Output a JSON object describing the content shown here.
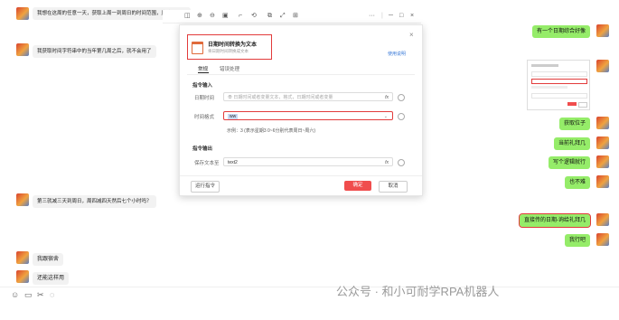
{
  "chat": {
    "messages_left": [
      "我想在这周的任意一天，获取上周一到周日的时间范围，应该怎么做",
      "我获取时间字符串中的当年第几周之后，就不会用了",
      "第三就减三天到周日，周四减四天然后七个小时吗？",
      "我跟宿舍",
      "还能这样用"
    ],
    "messages_right": [
      "有一个日期综合好像",
      "获取位子",
      "当前礼拜几",
      "写个逻辑就行",
      "也不难",
      "直接传的日期-询给礼拜几",
      "我行吧"
    ]
  },
  "dialog": {
    "title": "日期时间转换为文本",
    "subtitle": "将日期时间转换成文本",
    "help_link": "使用说明",
    "close_glyph": "×",
    "tabs": [
      "常规",
      "错误处理"
    ],
    "input_section": "指令输入",
    "label_datetime": "日期时间",
    "placeholder_datetime": "日期时间或者变量文本，格式，日期时间或者变量",
    "label_format": "时间格式",
    "format_value": "ww",
    "example": "示例：3 (表示星期3 0~6分别代表周日~周六)",
    "output_section": "指令输出",
    "label_save": "保存文本至",
    "save_value": "text2",
    "fx": "fx",
    "btn_test": "运行指令",
    "btn_ok": "确定",
    "btn_cancel": "取消"
  },
  "toolbar": {
    "icons": [
      "ruler-icon",
      "zoom-in-icon",
      "zoom-out-icon",
      "fit-icon",
      "crop-icon",
      "rotate-icon",
      "copy-icon",
      "expand-icon",
      "pin-icon"
    ],
    "glyphs": [
      "◫",
      "⊕",
      "⊖",
      "▣",
      "⌐",
      "⟲",
      "⧉",
      "⤢",
      "⊞"
    ],
    "window_controls": [
      "···",
      "|",
      "─",
      "□",
      "×"
    ]
  },
  "bottom_toolbar": {
    "glyphs": [
      "☺",
      "▭",
      "✂",
      "◌"
    ]
  },
  "watermark": "公众号 · 和小可耐学RPA机器人",
  "colors": {
    "accent_red": "#e23b3b",
    "green_bubble": "#95ec69",
    "link_blue": "#3b7bd8",
    "primary_btn": "#f04d4d"
  }
}
